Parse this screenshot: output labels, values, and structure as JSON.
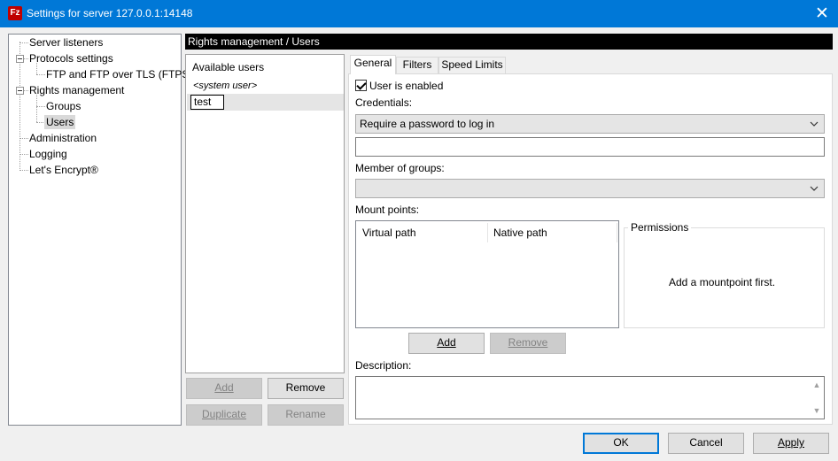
{
  "window": {
    "title": "Settings for server 127.0.0.1:14148",
    "app_icon_text": "Fz",
    "close_glyph": "✕"
  },
  "tree": {
    "items": [
      {
        "label": "Server listeners"
      },
      {
        "label": "Protocols settings"
      },
      {
        "label": "FTP and FTP over TLS (FTPS)"
      },
      {
        "label": "Rights management"
      },
      {
        "label": "Groups"
      },
      {
        "label": "Users",
        "selected": true
      },
      {
        "label": "Administration"
      },
      {
        "label": "Logging"
      },
      {
        "label": "Let's Encrypt®"
      }
    ]
  },
  "header": {
    "title": "Rights management / Users"
  },
  "users": {
    "caption": "Available users",
    "items": [
      {
        "label": "<system user>"
      },
      {
        "label": "test",
        "selected": true
      }
    ],
    "buttons": {
      "add": "Add",
      "remove": "Remove",
      "duplicate": "Duplicate",
      "rename": "Rename"
    }
  },
  "tabs": [
    {
      "label": "General",
      "active": true
    },
    {
      "label": "Filters"
    },
    {
      "label": "Speed Limits"
    }
  ],
  "general": {
    "user_enabled_label": "User is enabled",
    "user_enabled_checked": true,
    "credentials_label": "Credentials:",
    "credentials_value": "Require a password to log in",
    "password_value": "",
    "member_of_groups_label": "Member of groups:",
    "member_of_groups_value": "",
    "mount_points_label": "Mount points:",
    "mount_columns": [
      "Virtual path",
      "Native path"
    ],
    "permissions_title": "Permissions",
    "permissions_placeholder": "Add a mountpoint first.",
    "mount_add": "Add",
    "mount_remove": "Remove",
    "description_label": "Description:",
    "description_value": ""
  },
  "footer": {
    "ok": "OK",
    "cancel": "Cancel",
    "apply": "Apply"
  },
  "icons": {
    "chevron": "chevron-down-icon",
    "scroll_up": "▲",
    "scroll_down": "▼"
  },
  "colors": {
    "titlebar": "#0078d7",
    "header_bar": "#000000",
    "selection": "#d9d9d9"
  }
}
